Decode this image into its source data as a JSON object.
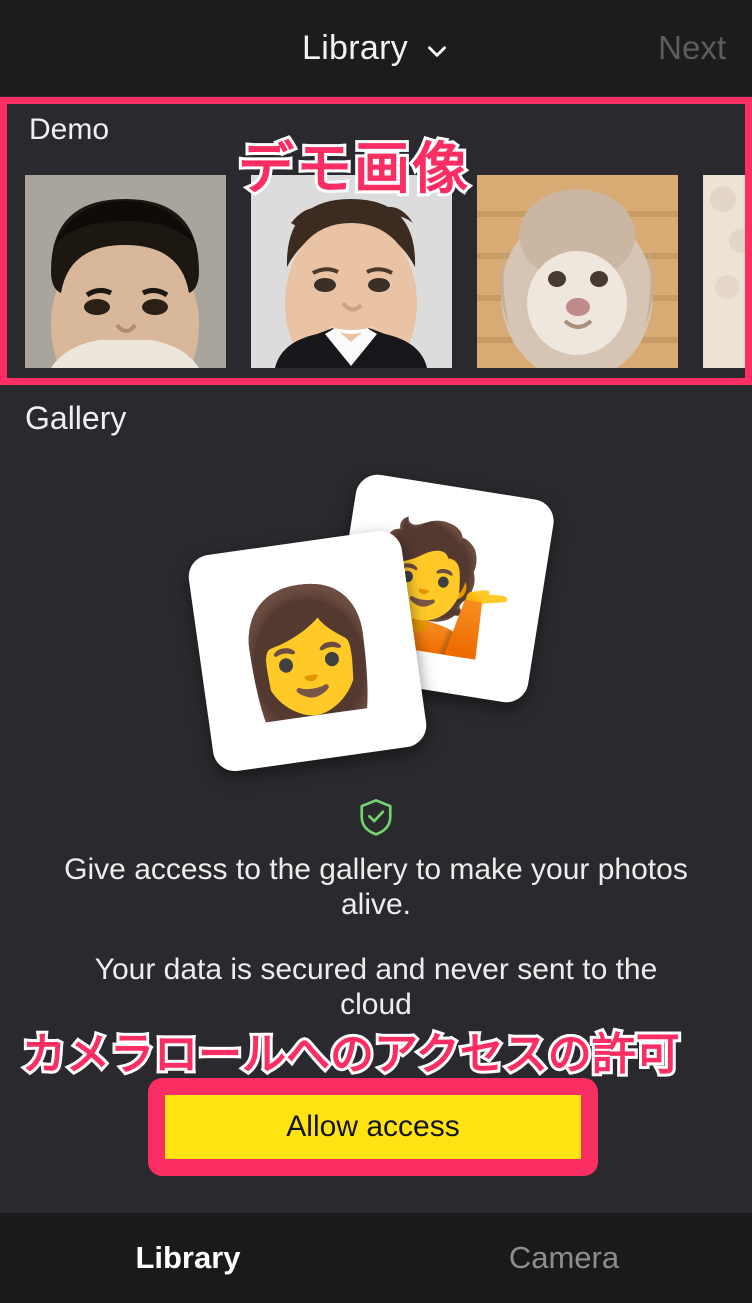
{
  "header": {
    "title": "Library",
    "chevron_icon": "chevron-down-icon",
    "next_label": "Next",
    "next_color": "#5d5d5d"
  },
  "demo": {
    "section_label": "Demo",
    "annotation_text": "デモ画像",
    "annotation_color": "#fa2e63",
    "thumbnails": [
      {
        "alt": "Portrait of a man with short dark hair on a grey backdrop"
      },
      {
        "alt": "Portrait of a man with short brown hair in a dark suit"
      },
      {
        "alt": "Fluffy cream colored dog in front of wooden planks"
      },
      {
        "alt": "Cream textured fabric with pink cloth"
      }
    ]
  },
  "gallery": {
    "section_label": "Gallery",
    "cards": [
      {
        "emoji": "💁",
        "name": "tipping-hand-person-emoji"
      },
      {
        "emoji": "👩",
        "name": "woman-emoji"
      }
    ],
    "shield_icon": "shield-check-icon",
    "shield_color": "#74d16f",
    "description_primary": "Give access to the gallery to make your photos alive.",
    "description_secondary": "Your data is secured and never sent to the cloud"
  },
  "allow": {
    "annotation_text": "カメラロールへのアクセスの許可",
    "button_label": "Allow access",
    "button_color": "#ffe313",
    "annotation_color": "#fa2e63"
  },
  "tabbar": {
    "tabs": [
      {
        "label": "Library",
        "active": true
      },
      {
        "label": "Camera",
        "active": false
      }
    ]
  }
}
